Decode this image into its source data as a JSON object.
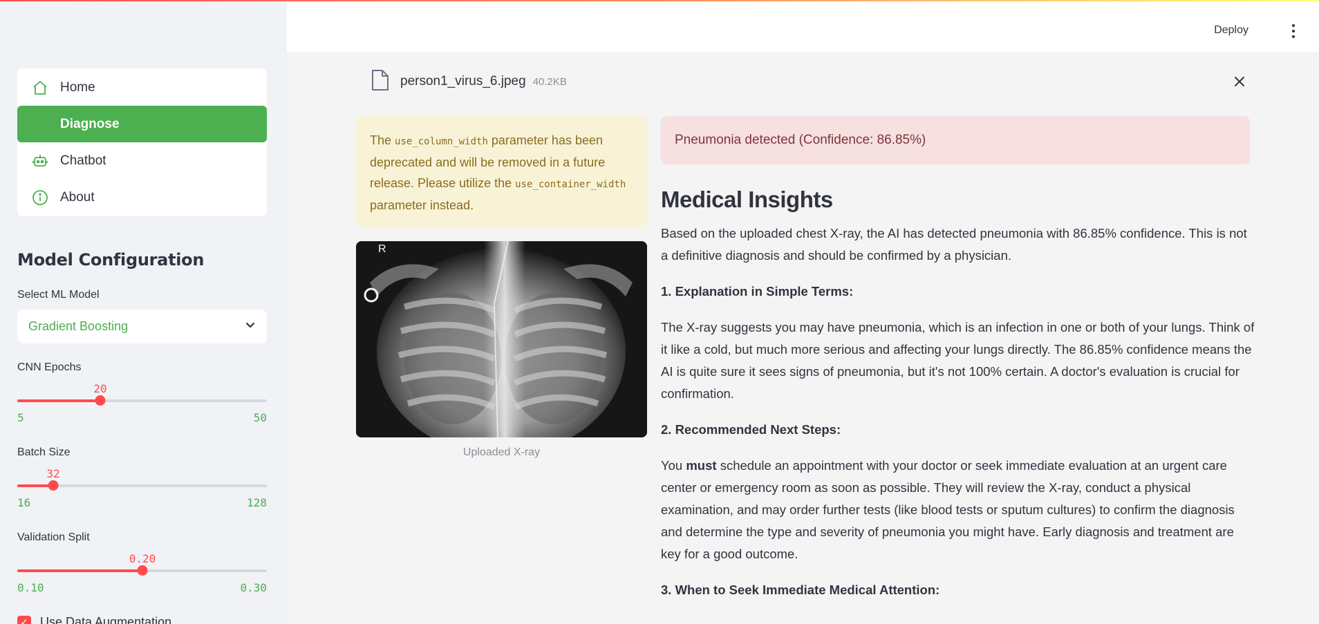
{
  "header": {
    "deploy_label": "Deploy"
  },
  "sidebar": {
    "nav": [
      {
        "label": "Home",
        "icon": "home-icon"
      },
      {
        "label": "Diagnose",
        "icon": "stethoscope-icon",
        "active": true
      },
      {
        "label": "Chatbot",
        "icon": "robot-icon"
      },
      {
        "label": "About",
        "icon": "info-icon"
      }
    ],
    "section_title": "Model Configuration",
    "model_select": {
      "label": "Select ML Model",
      "value": "Gradient Boosting"
    },
    "cnn_epochs": {
      "label": "CNN Epochs",
      "value": "20",
      "min": "5",
      "max": "50",
      "fraction": 0.333
    },
    "batch_size": {
      "label": "Batch Size",
      "value": "32",
      "min": "16",
      "max": "128",
      "fraction": 0.143
    },
    "validation_split": {
      "label": "Validation Split",
      "value": "0.20",
      "min": "0.10",
      "max": "0.30",
      "fraction": 0.5
    },
    "augmentation": {
      "label": "Use Data Augmentation",
      "checked": true
    }
  },
  "upload": {
    "file_name": "person1_virus_6.jpeg",
    "file_size": "40.2KB"
  },
  "warning": {
    "text_1": "The ",
    "code_1": "use_column_width",
    "text_2": " parameter has been deprecated and will be removed in a future release. Please utilize the ",
    "code_2": "use_container_width",
    "text_3": " parameter instead."
  },
  "image": {
    "caption": "Uploaded X-ray",
    "marker": "R"
  },
  "result": {
    "text": "Pneumonia detected (Confidence: 86.85%)"
  },
  "insights": {
    "title": "Medical Insights",
    "intro": "Based on the uploaded chest X-ray, the AI has detected pneumonia with 86.85% confidence. This is not a definitive diagnosis and should be confirmed by a physician.",
    "h1": "1. Explanation in Simple Terms:",
    "p1": "The X-ray suggests you may have pneumonia, which is an infection in one or both of your lungs. Think of it like a cold, but much more serious and affecting your lungs directly. The 86.85% confidence means the AI is quite sure it sees signs of pneumonia, but it's not 100% certain. A doctor's evaluation is crucial for confirmation.",
    "h2": "2. Recommended Next Steps:",
    "p2_a": "You ",
    "p2_b": "must",
    "p2_c": " schedule an appointment with your doctor or seek immediate evaluation at an urgent care center or emergency room as soon as possible. They will review the X-ray, conduct a physical examination, and may order further tests (like blood tests or sputum cultures) to confirm the diagnosis and determine the type and severity of pneumonia you might have. Early diagnosis and treatment are key for a good outcome.",
    "h3": "3. When to Seek Immediate Medical Attention:"
  },
  "colors": {
    "accent": "#ff4b4b",
    "green": "#4caf50",
    "sidebar_bg": "#f0f2f6",
    "warning_bg": "#f8f3d7",
    "error_bg": "#f6e0e0"
  }
}
